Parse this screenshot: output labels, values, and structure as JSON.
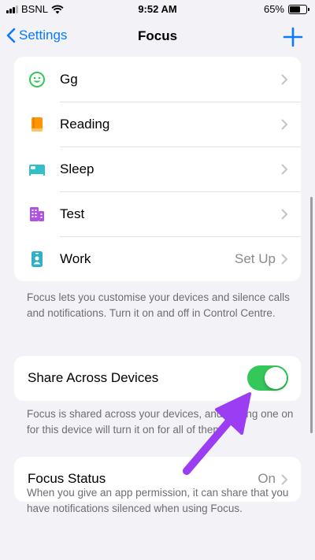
{
  "status_bar": {
    "carrier": "BSNL",
    "time": "9:52 AM",
    "battery": "65%",
    "icons": [
      "signal-bars-icon",
      "wifi-icon",
      "battery-icon"
    ]
  },
  "nav": {
    "back_label": "Settings",
    "title": "Focus",
    "add_icon": "plus-icon"
  },
  "focus_modes": [
    {
      "label": "Gg",
      "value": "",
      "icon": "smiley-icon",
      "color": "#34c759"
    },
    {
      "label": "Reading",
      "value": "",
      "icon": "book-icon",
      "color": "#ff9500"
    },
    {
      "label": "Sleep",
      "value": "",
      "icon": "bed-icon",
      "color": "#30c0c6"
    },
    {
      "label": "Test",
      "value": "",
      "icon": "building-icon",
      "color": "#af52de"
    },
    {
      "label": "Work",
      "value": "Set Up",
      "icon": "id-badge-icon",
      "color": "#30b0c7"
    }
  ],
  "modes_footer": "Focus lets you customise your devices and silence calls and notifications. Turn it on and off in Control Centre.",
  "share": {
    "label": "Share Across Devices",
    "enabled": true,
    "footer": "Focus is shared across your devices, and turning one on for this device will turn it on for all of them."
  },
  "focus_status": {
    "label": "Focus Status",
    "value": "On",
    "footer": "When you give an app permission, it can share that you have notifications silenced when using Focus."
  },
  "colors": {
    "accent": "#0a7aff",
    "toggle_on": "#34c759",
    "annotation_arrow": "#9b3df2"
  }
}
